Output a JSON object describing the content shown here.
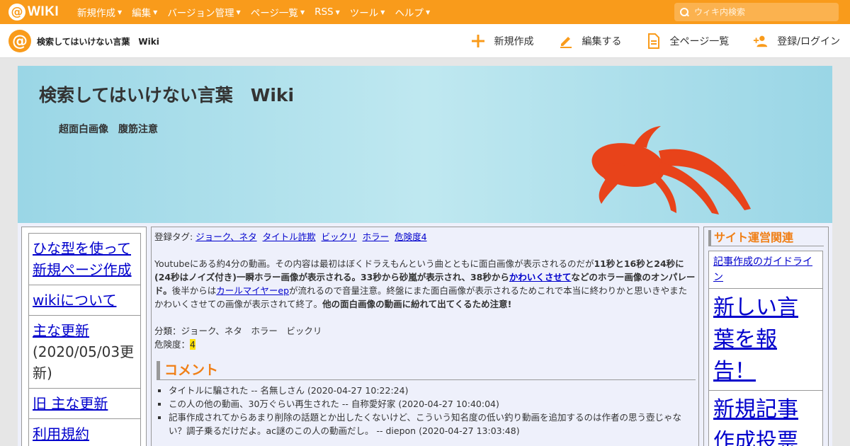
{
  "topbar": {
    "logo_text": "WIKI",
    "nav": [
      {
        "label": "新規作成"
      },
      {
        "label": "編集"
      },
      {
        "label": "バージョン管理"
      },
      {
        "label": "ページ一覧"
      },
      {
        "label": "RSS"
      },
      {
        "label": "ツール"
      },
      {
        "label": "ヘルプ"
      }
    ],
    "search_placeholder": "ウィキ内検索"
  },
  "subbar": {
    "site_name": "検索してはいけない言葉　Wiki",
    "actions": [
      {
        "label": "新規作成",
        "icon": "plus-icon"
      },
      {
        "label": "編集する",
        "icon": "pencil-icon"
      },
      {
        "label": "全ページ一覧",
        "icon": "document-icon"
      },
      {
        "label": "登録/ログイン",
        "icon": "add-user-icon"
      }
    ]
  },
  "banner": {
    "title": "検索してはいけない言葉　Wiki",
    "subtitle": "超面白画像　腹筋注意"
  },
  "left_menu": {
    "item1_link": "ひな型を使って新規ページ作成",
    "item2_link": "wikiについて",
    "item3_link": "主な更新",
    "item3_note": "(2020/05/03更新)",
    "item4_link": "旧 主な更新",
    "item5_link": "利用規約"
  },
  "article": {
    "tags_label": "登録タグ:",
    "tags": [
      "ジョーク、ネタ",
      "タイトル詐欺",
      "ビックリ",
      "ホラー",
      "危険度4"
    ],
    "p1": "Youtubeにある約4分の動画。その内容は最初はぼくドラえもんという曲とともに面白画像が表示されるのだが",
    "p2_bold": "11秒と16秒と24秒に(24秒はノイズ付き)一瞬ホラー画像が表示される。33秒から砂嵐が表示され、38秒から",
    "p3_link": "かわいくさせて",
    "p4_bold": "などのホラー画像のオンパレード。",
    "p5": "後半からは",
    "p6_link": "カールマイヤーep",
    "p7": "が流れるので音量注意。終盤にまた面白画像が表示されるためこれで本当に終わりかと思いきやまたかわいくさせての画像が表示されて終了。",
    "p8_bold": "他の面白画像の動画に紛れて出てくるため注意!",
    "category": "分類：ジョーク、ネタ　ホラー　ビックリ",
    "danger_label": "危険度：",
    "danger_value": "4",
    "comments_heading": "コメント",
    "comments": [
      "タイトルに騙された -- 名無しさん (2020-04-27 10:22:24)",
      "この人の他の動画、30万ぐらい再生された -- 自称愛好家 (2020-04-27 10:40:04)",
      "記事作成されてからあまり削除の話題とか出したくないけど、こういう知名度の低い釣り動画を追加するのは作者の思う壺じゃない？調子乗るだけだよ。ac謎のこの人の動画だし。 -- diepon (2020-04-27 13:03:48)"
    ]
  },
  "right_menu": {
    "heading": "サイト運営関連",
    "item1_link": "記事作成のガイドライン",
    "item2_link": "新しい言葉を報告！",
    "item3_link": "新規記事作成投票"
  },
  "colors": {
    "brand_orange": "#f99b1b",
    "link_blue": "#0000cc",
    "heading_orange": "#f07f16",
    "fish": "#e8431a"
  }
}
